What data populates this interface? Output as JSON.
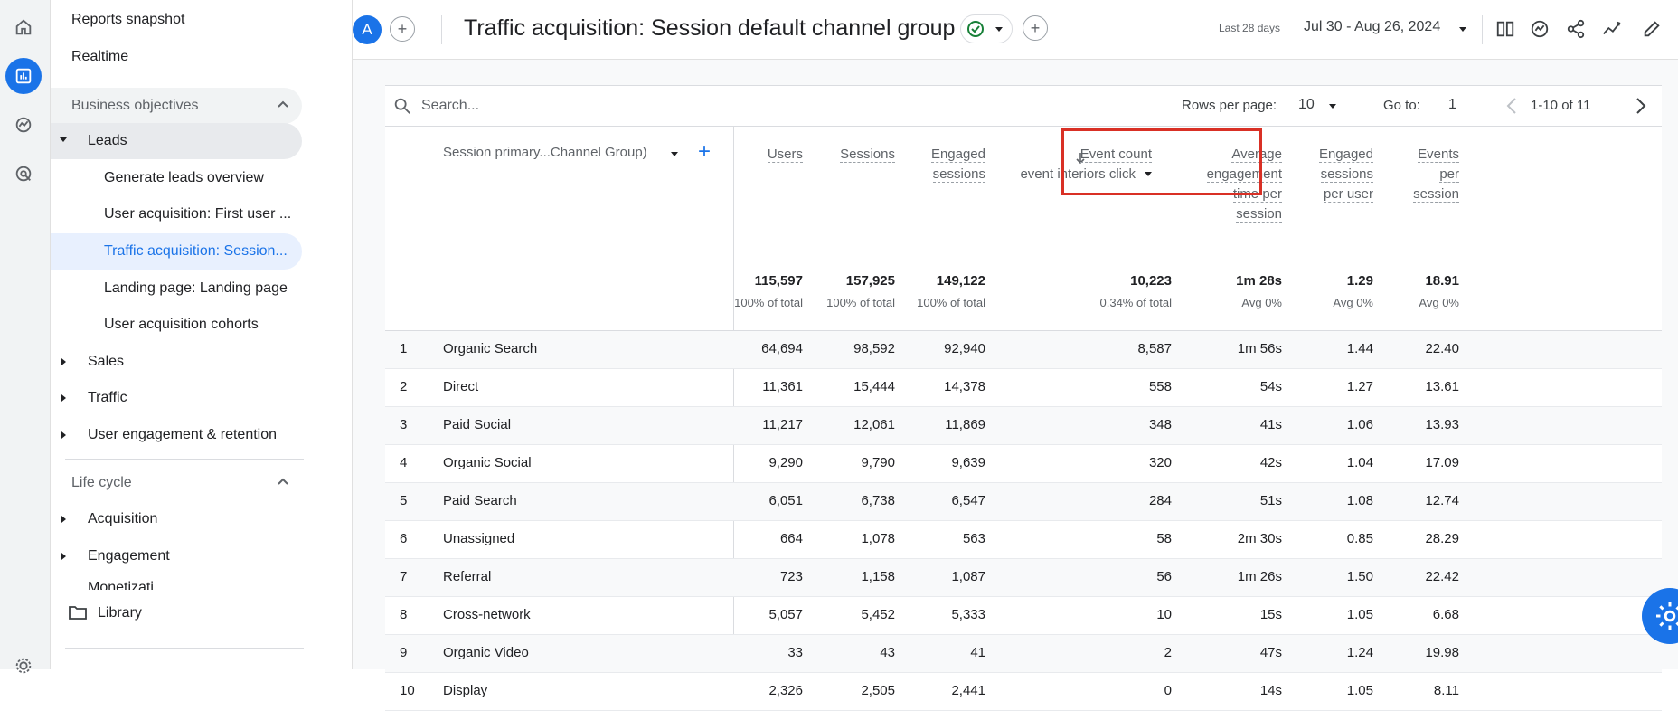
{
  "sidebar": {
    "reports_snapshot": "Reports snapshot",
    "realtime": "Realtime",
    "business_objectives": "Business objectives",
    "leads": "Leads",
    "leads_children": [
      "Generate leads overview",
      "User acquisition: First user ...",
      "Traffic acquisition: Session...",
      "Landing page: Landing page",
      "User acquisition cohorts"
    ],
    "sales": "Sales",
    "traffic": "Traffic",
    "user_engagement": "User engagement & retention",
    "life_cycle": "Life cycle",
    "acquisition": "Acquisition",
    "engagement": "Engagement",
    "monetization_partial": "Monetizati...",
    "library": "Library"
  },
  "header": {
    "avatar_letter": "A",
    "title": "Traffic acquisition: Session default channel group",
    "date_label": "Last 28 days",
    "date_range": "Jul 30 - Aug 26, 2024"
  },
  "toolbar": {
    "search_placeholder": "Search...",
    "rows_per_page_label": "Rows per page:",
    "rows_per_page_value": "10",
    "goto_label": "Go to:",
    "goto_value": "1",
    "range_text": "1-10 of 11"
  },
  "table": {
    "dimension_header": "Session primary...Channel Group)",
    "columns": [
      {
        "label": [
          "Users"
        ]
      },
      {
        "label": [
          "Sessions"
        ]
      },
      {
        "label": [
          "Engaged",
          "sessions"
        ]
      },
      {
        "label": [
          "Event count"
        ],
        "sub_label": "event interiors click"
      },
      {
        "label": [
          "Average",
          "engagement",
          "time per",
          "session"
        ]
      },
      {
        "label": [
          "Engaged",
          "sessions",
          "per user"
        ]
      },
      {
        "label": [
          "Events",
          "per",
          "session"
        ]
      }
    ],
    "totals": [
      "115,597",
      "157,925",
      "149,122",
      "10,223",
      "1m 28s",
      "1.29",
      "18.91"
    ],
    "totals_sub": [
      "100% of total",
      "100% of total",
      "100% of total",
      "0.34% of total",
      "Avg 0%",
      "Avg 0%",
      "Avg 0%"
    ],
    "rows": [
      {
        "n": "1",
        "name": "Organic Search",
        "v": [
          "64,694",
          "98,592",
          "92,940",
          "8,587",
          "1m 56s",
          "1.44",
          "22.40"
        ]
      },
      {
        "n": "2",
        "name": "Direct",
        "v": [
          "11,361",
          "15,444",
          "14,378",
          "558",
          "54s",
          "1.27",
          "13.61"
        ]
      },
      {
        "n": "3",
        "name": "Paid Social",
        "v": [
          "11,217",
          "12,061",
          "11,869",
          "348",
          "41s",
          "1.06",
          "13.93"
        ]
      },
      {
        "n": "4",
        "name": "Organic Social",
        "v": [
          "9,290",
          "9,790",
          "9,639",
          "320",
          "42s",
          "1.04",
          "17.09"
        ]
      },
      {
        "n": "5",
        "name": "Paid Search",
        "v": [
          "6,051",
          "6,738",
          "6,547",
          "284",
          "51s",
          "1.08",
          "12.74"
        ]
      },
      {
        "n": "6",
        "name": "Unassigned",
        "v": [
          "664",
          "1,078",
          "563",
          "58",
          "2m 30s",
          "0.85",
          "28.29"
        ]
      },
      {
        "n": "7",
        "name": "Referral",
        "v": [
          "723",
          "1,158",
          "1,087",
          "56",
          "1m 26s",
          "1.50",
          "22.42"
        ]
      },
      {
        "n": "8",
        "name": "Cross-network",
        "v": [
          "5,057",
          "5,452",
          "5,333",
          "10",
          "15s",
          "1.05",
          "6.68"
        ]
      },
      {
        "n": "9",
        "name": "Organic Video",
        "v": [
          "33",
          "43",
          "41",
          "2",
          "47s",
          "1.24",
          "19.98"
        ]
      },
      {
        "n": "10",
        "name": "Display",
        "v": [
          "2,326",
          "2,505",
          "2,441",
          "0",
          "14s",
          "1.05",
          "8.11"
        ]
      }
    ]
  },
  "colors": {
    "accent": "#1a73e8",
    "highlight": "#d93025",
    "check": "#188038"
  }
}
